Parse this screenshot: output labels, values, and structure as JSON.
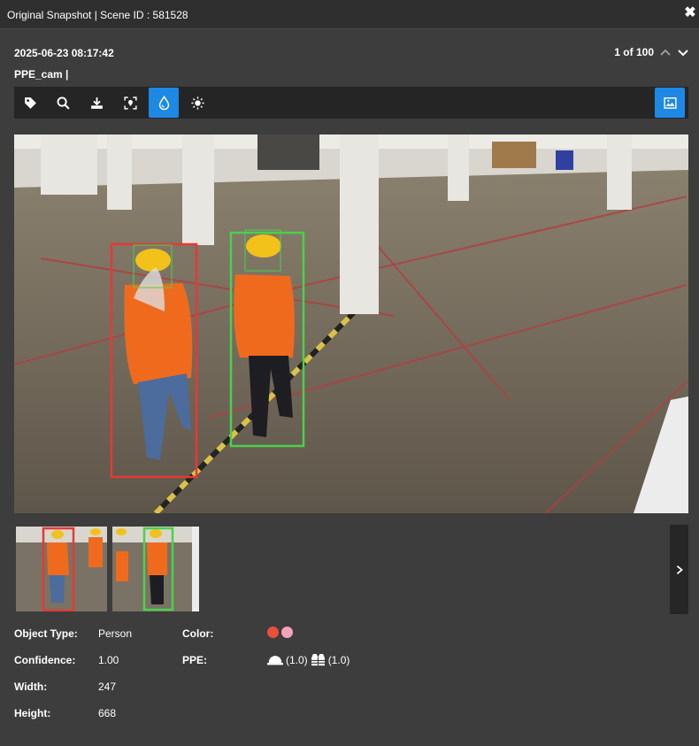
{
  "window": {
    "title": "Original Snapshot | Scene ID : 581528",
    "close_icon": "close-icon"
  },
  "meta": {
    "timestamp": "2025-06-23 08:17:42",
    "camera": "PPE_cam |"
  },
  "pager": {
    "count": "1 of 100"
  },
  "toolbar": {
    "tools": [
      {
        "icon": "tag-icon",
        "active": false
      },
      {
        "icon": "search-icon",
        "active": false
      },
      {
        "icon": "download-icon",
        "active": false
      },
      {
        "icon": "focus-location-icon",
        "active": false
      },
      {
        "icon": "water-drop-icon",
        "active": true
      },
      {
        "icon": "brightness-icon",
        "active": false
      }
    ],
    "right_tool": {
      "icon": "image-icon",
      "active": true
    }
  },
  "colors": {
    "accent": "#1e88e5",
    "red_box": "#e53935",
    "green_box": "#4cd04c",
    "color_swatch_1": "#e8503a",
    "color_swatch_2": "#f4a3b8"
  },
  "details": {
    "object_type_label": "Object Type:",
    "object_type_value": "Person",
    "confidence_label": "Confidence:",
    "confidence_value": "1.00",
    "width_label": "Width:",
    "width_value": "247",
    "height_label": "Height:",
    "height_value": "668",
    "color_label": "Color:",
    "ppe_label": "PPE:",
    "ppe_helmet_value": "(1.0)",
    "ppe_vest_value": "(1.0)"
  }
}
